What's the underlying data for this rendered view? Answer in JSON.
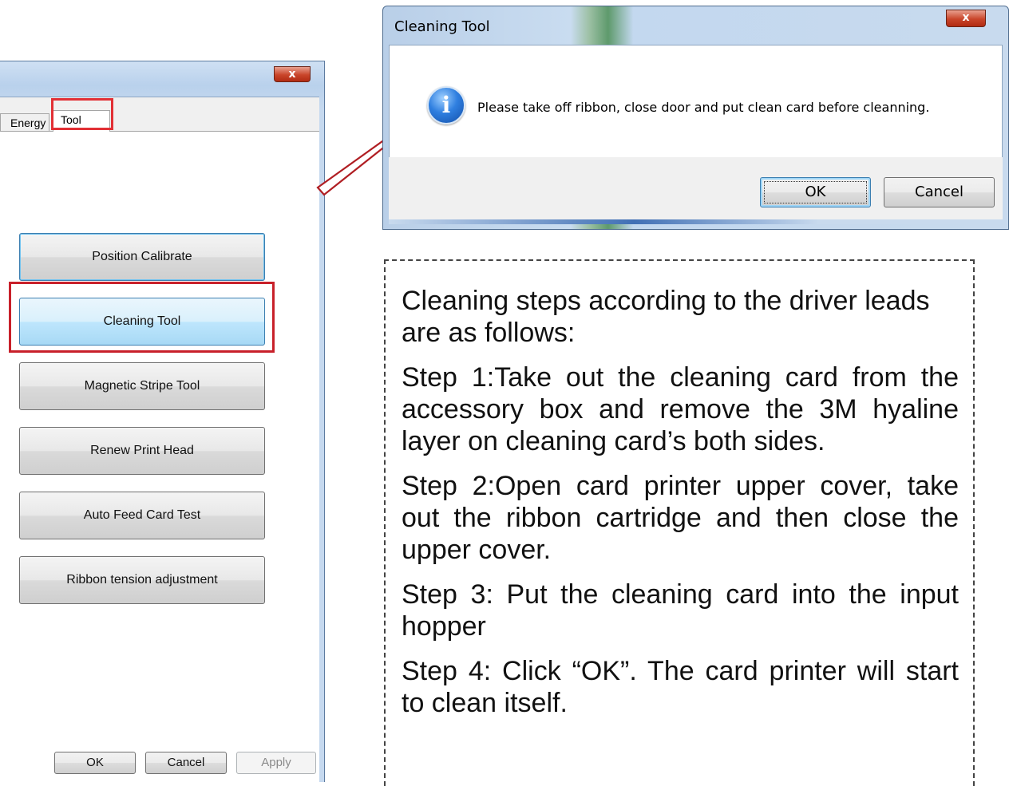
{
  "left_window": {
    "close_glyph": "x",
    "tabs": [
      {
        "label": "Energy"
      },
      {
        "label": "Tool"
      }
    ],
    "tool_buttons": [
      {
        "label": "Position Calibrate"
      },
      {
        "label": "Cleaning Tool"
      },
      {
        "label": "Magnetic Stripe Tool"
      },
      {
        "label": "Renew Print Head"
      },
      {
        "label": "Auto Feed Card Test"
      },
      {
        "label": "Ribbon tension adjustment"
      }
    ],
    "footer": {
      "ok": "OK",
      "cancel": "Cancel",
      "apply": "Apply"
    }
  },
  "message_box": {
    "title": "Cleaning Tool",
    "close_glyph": "x",
    "icon": "info-icon",
    "icon_glyph": "i",
    "message": "Please take off ribbon, close door and put clean card before cleanning.",
    "ok": "OK",
    "cancel": "Cancel"
  },
  "instructions": {
    "intro": "Cleaning steps according to the driver leads are as follows:",
    "steps": [
      "Step 1:Take out the cleaning card from the accessory box and remove the 3M hyaline layer on cleaning card’s both sides.",
      "Step 2:Open card printer upper cover, take out the ribbon cartridge and then close the upper cover.",
      "Step 3: Put the cleaning card into the input hopper",
      "Step 4: Click “OK”. The card printer will start to clean itself."
    ]
  },
  "colors": {
    "highlight_red": "#c8202a",
    "arrow_red": "#b01e23",
    "title_blue": "#b9d1ec"
  }
}
